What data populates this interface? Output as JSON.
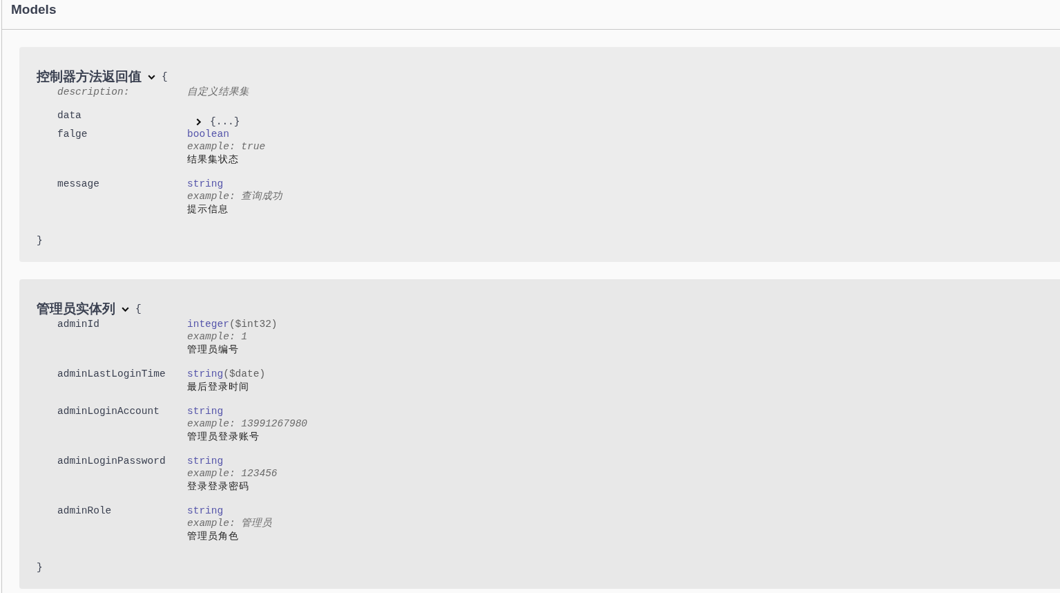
{
  "section_title": "Models",
  "models": [
    {
      "title": "控制器方法返回值",
      "expanded": true,
      "open_brace": "{",
      "close_brace": "}",
      "properties": [
        {
          "kind": "description",
          "name": "description:",
          "value": "自定义结果集"
        },
        {
          "kind": "object",
          "name": "data",
          "expanded": false,
          "summary": "{...}"
        },
        {
          "kind": "field",
          "name": "falge",
          "type": "boolean",
          "example_label": "example:",
          "example": "true",
          "description": "结果集状态"
        },
        {
          "kind": "field",
          "name": "message",
          "type": "string",
          "example_label": "example:",
          "example": "查询成功",
          "description": "提示信息"
        }
      ]
    },
    {
      "title": "管理员实体列",
      "expanded": true,
      "open_brace": "{",
      "close_brace": "}",
      "properties": [
        {
          "kind": "field",
          "name": "adminId",
          "type": "integer",
          "format": "($int32)",
          "example_label": "example:",
          "example": "1",
          "description": "管理员编号"
        },
        {
          "kind": "field",
          "name": "adminLastLoginTime",
          "type": "string",
          "format": "($date)",
          "description": "最后登录时间"
        },
        {
          "kind": "field",
          "name": "adminLoginAccount",
          "type": "string",
          "example_label": "example:",
          "example": "13991267980",
          "description": "管理员登录账号"
        },
        {
          "kind": "field",
          "name": "adminLoginPassword",
          "type": "string",
          "example_label": "example:",
          "example": "123456",
          "description": "登录登录密码"
        },
        {
          "kind": "field",
          "name": "adminRole",
          "type": "string",
          "example_label": "example:",
          "example": "管理员",
          "description": "管理员角色"
        }
      ]
    }
  ]
}
